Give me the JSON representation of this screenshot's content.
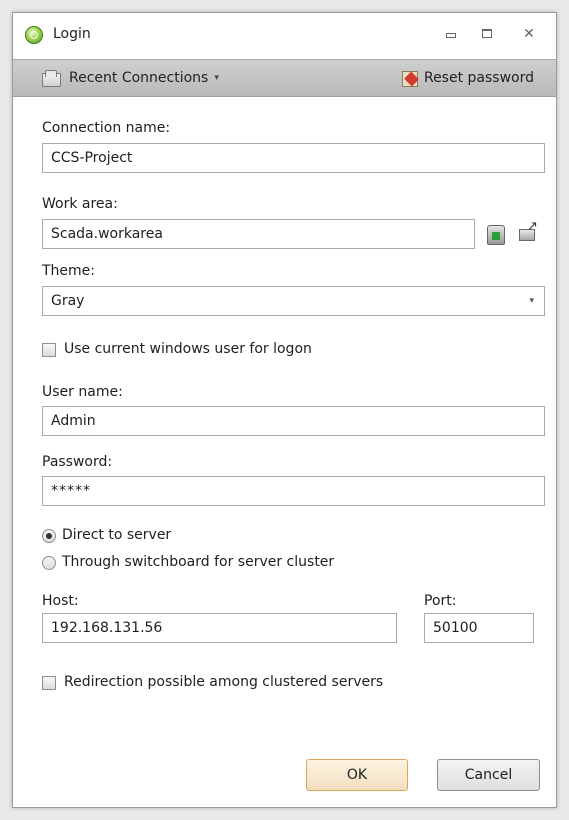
{
  "window": {
    "title": "Login",
    "minimize_glyph": "",
    "close_glyph": "✕"
  },
  "toolbar": {
    "recent_label": "Recent Connections",
    "recent_caret": "▾",
    "reset_label": "Reset password"
  },
  "form": {
    "connection_name_label": "Connection name:",
    "connection_name_value": "CCS-Project",
    "work_area_label": "Work area:",
    "work_area_value": "Scada.workarea",
    "theme_label": "Theme:",
    "theme_value": "Gray",
    "theme_caret": "▾",
    "use_windows_user_label": "Use current windows user for logon",
    "use_windows_user_checked": false,
    "user_name_label": "User name:",
    "user_name_value": "Admin",
    "password_label": "Password:",
    "password_value": "*****",
    "radio_direct_label": "Direct to server",
    "radio_switchboard_label": "Through switchboard for server cluster",
    "selected_connection_mode": "direct",
    "host_label": "Host:",
    "host_value": "192.168.131.56",
    "port_label": "Port:",
    "port_value": "50100",
    "redirection_label": "Redirection possible among clustered servers",
    "redirection_checked": false
  },
  "buttons": {
    "ok_label": "OK",
    "cancel_label": "Cancel"
  },
  "icons": {
    "app": "globe-icon",
    "recent": "folder-icon",
    "reset": "reset-password-icon",
    "db": "database-icon",
    "open": "open-folder-icon"
  },
  "colors": {
    "toolbar_bg": "#c4c4c4",
    "ok_border": "#d9a85a",
    "field_border": "#a9a9a9"
  }
}
